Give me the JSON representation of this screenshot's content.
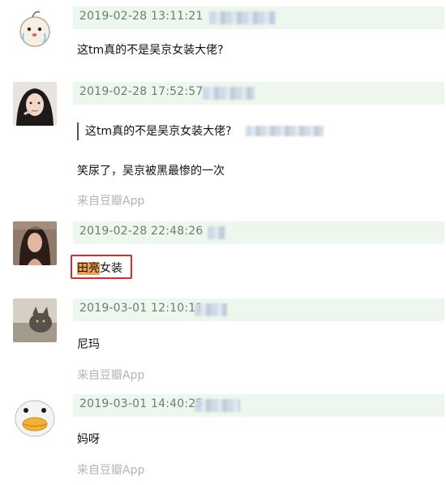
{
  "comments": [
    {
      "avatar": "cartoon-face-avatar",
      "time": "2019-02-28 13:11:21",
      "text": "这tm真的不是吴京女装大佬?"
    },
    {
      "avatar": "girl-photo-avatar",
      "time": "2019-02-28 17:52:57",
      "quote": "这tm真的不是吴京女装大佬?",
      "text": "笑尿了，吴京被黑最惨的一次",
      "source": "来自豆瓣App"
    },
    {
      "avatar": "woman-photo-avatar",
      "time": "2019-02-28 22:48:26",
      "text_highlight": "田亮",
      "text_rest": "女装"
    },
    {
      "avatar": "cat-photo-avatar",
      "time": "2019-03-01 12:10:11",
      "text": "尼玛",
      "source": "来自豆瓣App"
    },
    {
      "avatar": "duck-cartoon-avatar",
      "time": "2019-03-01 14:40:25",
      "text": "妈呀",
      "source": "来自豆瓣App"
    }
  ],
  "colors": {
    "meta_bar": "#eef7ee",
    "timestamp": "#6b7f6b",
    "source": "#b3b3b3",
    "highlight": "#f3a24f",
    "annotation_box": "#e0292c"
  }
}
